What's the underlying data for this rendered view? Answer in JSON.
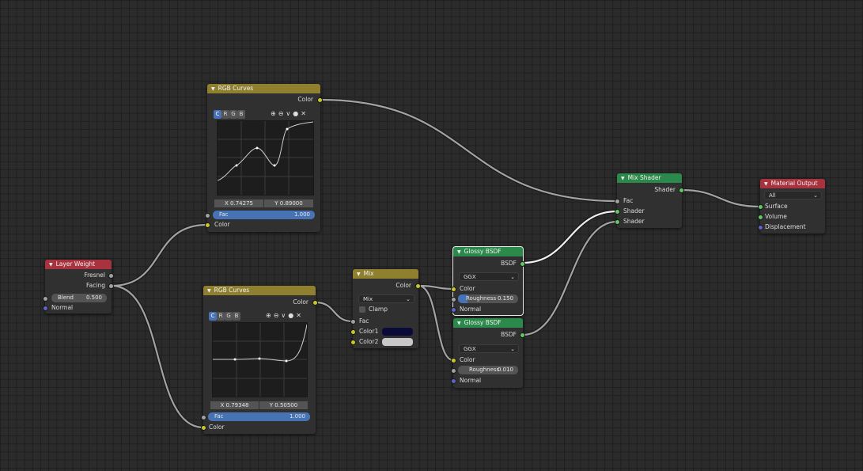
{
  "nodes": {
    "rgb_curves_1": {
      "title": "RGB Curves",
      "output": "Color",
      "tabs": [
        "C",
        "R",
        "G",
        "B"
      ],
      "tools": [
        "⊕",
        "⊖",
        "∨",
        "●",
        "✕"
      ],
      "x_value": "X 0.74275",
      "y_value": "Y 0.89000",
      "fac_label": "Fac",
      "fac_value": "1.000",
      "input_color": "Color"
    },
    "rgb_curves_2": {
      "title": "RGB Curves",
      "output": "Color",
      "tabs": [
        "C",
        "R",
        "G",
        "B"
      ],
      "tools": [
        "⊕",
        "⊖",
        "∨",
        "●",
        "✕"
      ],
      "x_value": "X 0.79348",
      "y_value": "Y 0.50500",
      "fac_label": "Fac",
      "fac_value": "1.000",
      "input_color": "Color"
    },
    "layer_weight": {
      "title": "Layer Weight",
      "outputs": [
        "Fresnel",
        "Facing"
      ],
      "blend_label": "Blend",
      "blend_value": "0.500",
      "normal": "Normal"
    },
    "mix": {
      "title": "Mix",
      "output": "Color",
      "mode": "Mix",
      "clamp": "Clamp",
      "fac": "Fac",
      "color1": "Color1",
      "color2": "Color2",
      "color1_hex": "#0b0b3a",
      "color2_hex": "#c8c8c8"
    },
    "glossy_1": {
      "title": "Glossy BSDF",
      "output": "BSDF",
      "distribution": "GGX",
      "color": "Color",
      "roughness_label": "Roughness",
      "roughness_value": "0.150",
      "normal": "Normal"
    },
    "glossy_2": {
      "title": "Glossy BSDF",
      "output": "BSDF",
      "distribution": "GGX",
      "color": "Color",
      "roughness_label": "Roughness",
      "roughness_value": "0.010",
      "normal": "Normal"
    },
    "mix_shader": {
      "title": "Mix Shader",
      "output": "Shader",
      "inputs": [
        "Fac",
        "Shader",
        "Shader"
      ]
    },
    "material_output": {
      "title": "Material Output",
      "target": "All",
      "inputs": [
        "Surface",
        "Volume",
        "Displacement"
      ]
    }
  },
  "colors": {
    "curves_header": "#8f8030",
    "input_header": "#a8333f",
    "shader_header": "#2b8a4b",
    "output_header": "#a8333f",
    "accent_blue": "#4772b3"
  }
}
